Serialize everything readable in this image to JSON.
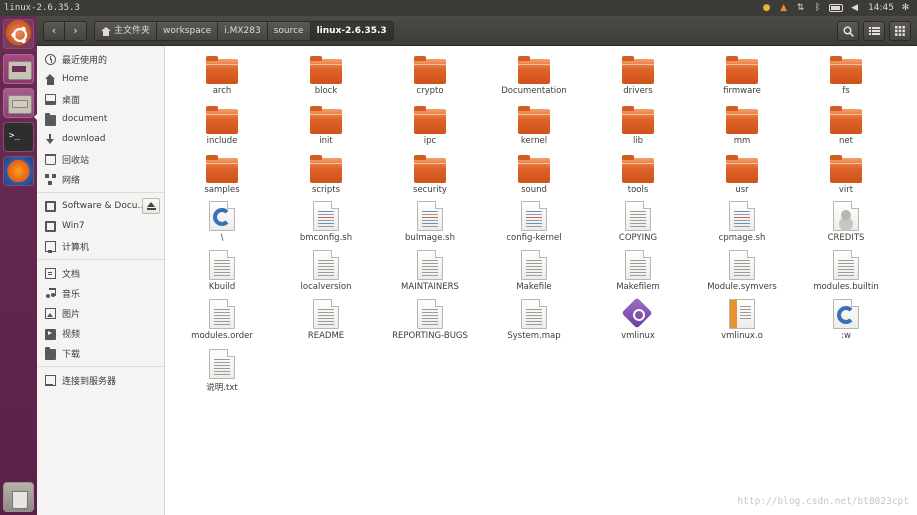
{
  "top_panel": {
    "title": "linux-2.6.35.3",
    "clock": "14:45",
    "tray_icons": [
      "chrome-icon",
      "vlc-icon",
      "network-icon",
      "bluetooth-icon",
      "battery-icon",
      "volume-icon",
      "power-gear-icon"
    ]
  },
  "toolbar": {
    "back_glyph": "‹",
    "forward_glyph": "›",
    "breadcrumbs": [
      "主文件夹",
      "workspace",
      "i.MX283",
      "source",
      "linux-2.6.35.3"
    ]
  },
  "sidebar": {
    "section1": [
      {
        "label": "最近使用的",
        "icon": "clock-icon"
      },
      {
        "label": "Home",
        "icon": "home-icon"
      },
      {
        "label": "桌面",
        "icon": "desktop-icon"
      },
      {
        "label": "document",
        "icon": "folder-icon"
      },
      {
        "label": "download",
        "icon": "download-icon"
      },
      {
        "label": "回收站",
        "icon": "trash-icon"
      },
      {
        "label": "网络",
        "icon": "network-icon"
      }
    ],
    "section2": [
      {
        "label": "Software & Docu…",
        "icon": "drive-icon"
      },
      {
        "label": "Win7",
        "icon": "drive-icon"
      },
      {
        "label": "计算机",
        "icon": "computer-icon"
      }
    ],
    "section3": [
      {
        "label": "文档",
        "icon": "documents-icon"
      },
      {
        "label": "音乐",
        "icon": "music-icon"
      },
      {
        "label": "图片",
        "icon": "pictures-icon"
      },
      {
        "label": "视频",
        "icon": "videos-icon"
      },
      {
        "label": "下载",
        "icon": "folder-icon"
      }
    ],
    "section4": [
      {
        "label": "连接到服务器",
        "icon": "server-icon"
      }
    ]
  },
  "files": [
    {
      "name": "arch",
      "type": "folder"
    },
    {
      "name": "block",
      "type": "folder"
    },
    {
      "name": "crypto",
      "type": "folder"
    },
    {
      "name": "Documentation",
      "type": "folder"
    },
    {
      "name": "drivers",
      "type": "folder"
    },
    {
      "name": "firmware",
      "type": "folder"
    },
    {
      "name": "fs",
      "type": "folder"
    },
    {
      "name": "include",
      "type": "folder"
    },
    {
      "name": "init",
      "type": "folder"
    },
    {
      "name": "ipc",
      "type": "folder"
    },
    {
      "name": "kernel",
      "type": "folder"
    },
    {
      "name": "lib",
      "type": "folder"
    },
    {
      "name": "mm",
      "type": "folder"
    },
    {
      "name": "net",
      "type": "folder"
    },
    {
      "name": "samples",
      "type": "folder"
    },
    {
      "name": "scripts",
      "type": "folder"
    },
    {
      "name": "security",
      "type": "folder"
    },
    {
      "name": "sound",
      "type": "folder"
    },
    {
      "name": "tools",
      "type": "folder"
    },
    {
      "name": "usr",
      "type": "folder"
    },
    {
      "name": "virt",
      "type": "folder"
    },
    {
      "name": "\\",
      "type": "csrc"
    },
    {
      "name": "bmconfig.sh",
      "type": "script"
    },
    {
      "name": "buImage.sh",
      "type": "script"
    },
    {
      "name": "config-kernel",
      "type": "script"
    },
    {
      "name": "COPYING",
      "type": "text"
    },
    {
      "name": "cpmage.sh",
      "type": "script"
    },
    {
      "name": "CREDITS",
      "type": "credits"
    },
    {
      "name": "Kbuild",
      "type": "text"
    },
    {
      "name": "localversion",
      "type": "text"
    },
    {
      "name": "MAINTAINERS",
      "type": "text"
    },
    {
      "name": "Makefile",
      "type": "text"
    },
    {
      "name": "Makefilem",
      "type": "text"
    },
    {
      "name": "Module.symvers",
      "type": "text"
    },
    {
      "name": "modules.builtin",
      "type": "text"
    },
    {
      "name": "modules.order",
      "type": "text"
    },
    {
      "name": "README",
      "type": "text"
    },
    {
      "name": "REPORTING-BUGS",
      "type": "text"
    },
    {
      "name": "System.map",
      "type": "text"
    },
    {
      "name": "vmlinux",
      "type": "executable"
    },
    {
      "name": "vmlinux.o",
      "type": "object"
    },
    {
      "name": ":w",
      "type": "csrc"
    },
    {
      "name": "说明.txt",
      "type": "text"
    }
  ],
  "watermark": "http://blog.csdn.net/bt8023cpt",
  "colors": {
    "folder": "#e0652a",
    "panel": "#3c3b37",
    "launcher": "#5a2147"
  }
}
